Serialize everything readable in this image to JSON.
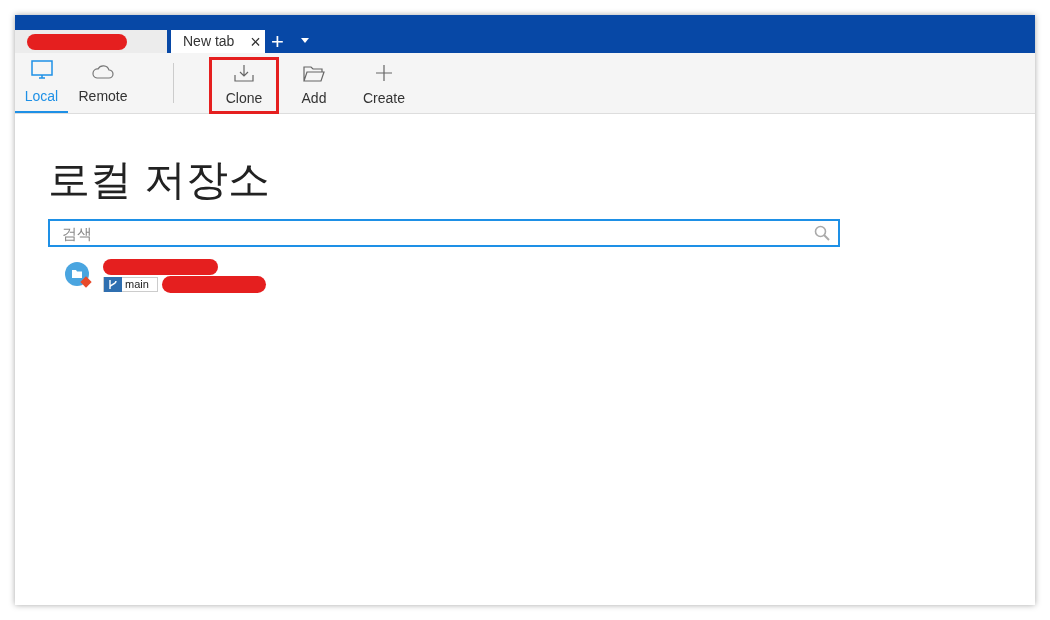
{
  "tabs": [
    {
      "selected": false
    },
    {
      "label": "New tab",
      "selected": true,
      "close": "×"
    }
  ],
  "tab_actions": {
    "add": "+"
  },
  "views": [
    {
      "label": "Local",
      "selected": true,
      "kind": "monitor"
    },
    {
      "label": "Remote",
      "selected": false,
      "kind": "cloud"
    }
  ],
  "actions": [
    {
      "label": "Clone",
      "highlighted": true,
      "kind": "download"
    },
    {
      "label": "Add",
      "highlighted": false,
      "kind": "folder"
    },
    {
      "label": "Create",
      "highlighted": false,
      "kind": "plus"
    }
  ],
  "heading": "로컬 저장소",
  "search": {
    "placeholder": "검색"
  },
  "repositories": [
    {
      "branch": "main"
    }
  ]
}
